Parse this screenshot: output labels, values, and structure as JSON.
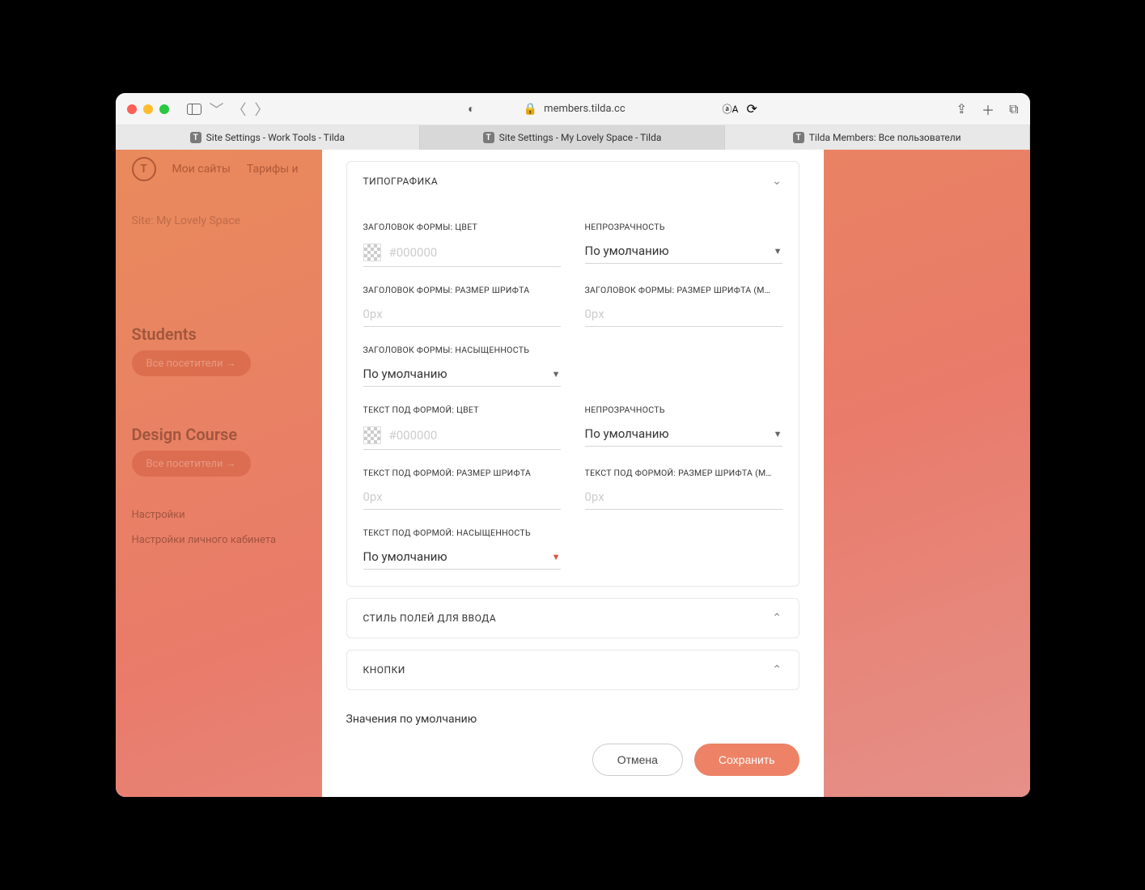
{
  "browser": {
    "url": "members.tilda.cc",
    "tabs": [
      {
        "label": "Site Settings - Work Tools - Tilda"
      },
      {
        "label": "Site Settings - My Lovely Space - Tilda"
      },
      {
        "label": "Tilda Members: Все пользователи"
      }
    ]
  },
  "background": {
    "nav": {
      "mysites": "Мои сайты",
      "tariffs": "Тарифы и"
    },
    "site_title": "Site: My Lovely Space",
    "students_h": "Students",
    "students_btn": "Все посетители →",
    "design_h": "Design Course",
    "design_btn": "Все посетители →",
    "link1": "Настройки",
    "link2": "Настройки личного кабинета"
  },
  "modal": {
    "section_typography": "ТИПОГРАФИКА",
    "section_input_style": "СТИЛЬ ПОЛЕЙ ДЛЯ ВВОДА",
    "section_buttons": "КНОПКИ",
    "fields": {
      "form_title_color": {
        "label": "ЗАГОЛОВОК ФОРМЫ: ЦВЕТ",
        "placeholder": "#000000"
      },
      "opacity1": {
        "label": "НЕПРОЗРАЧНОСТЬ",
        "value": "По умолчанию"
      },
      "form_title_size": {
        "label": "ЗАГОЛОВОК ФОРМЫ: РАЗМЕР ШРИФТА",
        "placeholder": "0px"
      },
      "form_title_size_m": {
        "label": "ЗАГОЛОВОК ФОРМЫ: РАЗМЕР ШРИФТА (М…",
        "placeholder": "0px"
      },
      "form_title_weight": {
        "label": "ЗАГОЛОВОК ФОРМЫ: НАСЫЩЕННОСТЬ",
        "value": "По умолчанию"
      },
      "under_text_color": {
        "label": "ТЕКСТ ПОД ФОРМОЙ: ЦВЕТ",
        "placeholder": "#000000"
      },
      "opacity2": {
        "label": "НЕПРОЗРАЧНОСТЬ",
        "value": "По умолчанию"
      },
      "under_text_size": {
        "label": "ТЕКСТ ПОД ФОРМОЙ: РАЗМЕР ШРИФТА",
        "placeholder": "0px"
      },
      "under_text_size_m": {
        "label": "ТЕКСТ ПОД ФОРМОЙ: РАЗМЕР ШРИФТА (М…",
        "placeholder": "0px"
      },
      "under_text_weight": {
        "label": "ТЕКСТ ПОД ФОРМОЙ: НАСЫЩЕННОСТЬ",
        "value": "По умолчанию"
      }
    },
    "defaults_label": "Значения по умолчанию",
    "cancel": "Отмена",
    "save": "Сохранить"
  }
}
